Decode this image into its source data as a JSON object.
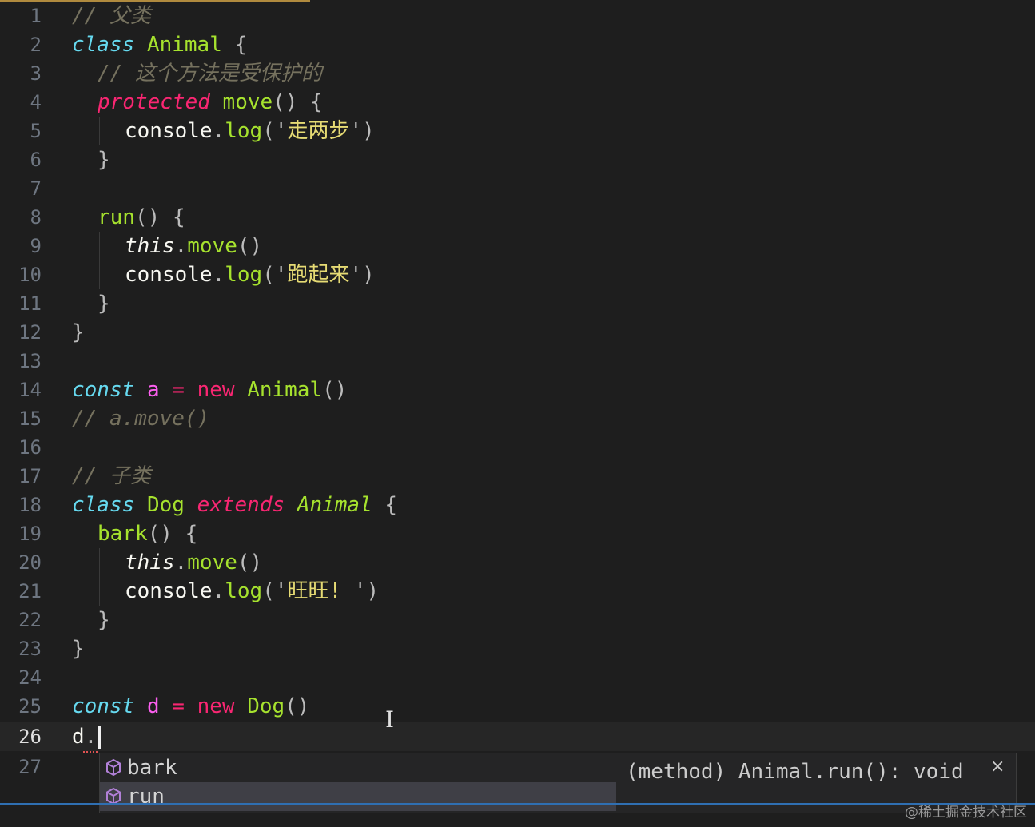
{
  "editor": {
    "line_numbers": [
      "1",
      "2",
      "3",
      "4",
      "5",
      "6",
      "7",
      "8",
      "9",
      "10",
      "11",
      "12",
      "13",
      "14",
      "15",
      "16",
      "17",
      "18",
      "19",
      "20",
      "21",
      "22",
      "23",
      "24",
      "25",
      "26",
      "27"
    ],
    "current_line": "26"
  },
  "code": {
    "l1": {
      "comment": "// 父类"
    },
    "l2": {
      "kw": "class",
      "name": "Animal",
      "brace": "{"
    },
    "l3": {
      "comment": "// 这个方法是受保护的"
    },
    "l4": {
      "mod": "protected",
      "fn": "move",
      "parens": "()",
      "brace": "{"
    },
    "l5": {
      "obj": "console",
      "dot": ".",
      "fn": "log",
      "open": "('",
      "str": "走两步",
      "close": "')"
    },
    "l6": {
      "brace": "}"
    },
    "l8": {
      "fn": "run",
      "parens": "()",
      "brace": "{"
    },
    "l9": {
      "this": "this",
      "dot": ".",
      "fn": "move",
      "parens": "()"
    },
    "l10": {
      "obj": "console",
      "dot": ".",
      "fn": "log",
      "open": "('",
      "str": "跑起来",
      "close": "')"
    },
    "l11": {
      "brace": "}"
    },
    "l12": {
      "brace": "}"
    },
    "l14": {
      "kw": "const",
      "var": "a",
      "op": "=",
      "new": "new",
      "cls": "Animal",
      "parens": "()"
    },
    "l15": {
      "comment": "// a.move()"
    },
    "l17": {
      "comment": "// 子类"
    },
    "l18": {
      "kw": "class",
      "name": "Dog",
      "ext": "extends",
      "parent": "Animal",
      "brace": "{"
    },
    "l19": {
      "fn": "bark",
      "parens": "()",
      "brace": "{"
    },
    "l20": {
      "this": "this",
      "dot": ".",
      "fn": "move",
      "parens": "()"
    },
    "l21": {
      "obj": "console",
      "dot": ".",
      "fn": "log",
      "open": "('",
      "str": "旺旺! ",
      "close": "')"
    },
    "l22": {
      "brace": "}"
    },
    "l23": {
      "brace": "}"
    },
    "l25": {
      "kw": "const",
      "var": "d",
      "op": "=",
      "new": "new",
      "cls": "Dog",
      "parens": "()"
    },
    "l26": {
      "obj": "d",
      "dot": "."
    }
  },
  "suggest": {
    "items": [
      {
        "label": "bark",
        "icon": "method-cube-icon",
        "selected": false
      },
      {
        "label": "run",
        "icon": "method-cube-icon",
        "selected": true
      }
    ],
    "detail": "(method) Animal.run(): void",
    "close_glyph": "×"
  },
  "watermark": "@稀土掘金技术社区",
  "colors": {
    "background": "#1e1e1e",
    "keyword": "#66d9ef",
    "function": "#a6e22e",
    "operator": "#f92672",
    "comment": "#75715e",
    "string": "#e6db74"
  }
}
